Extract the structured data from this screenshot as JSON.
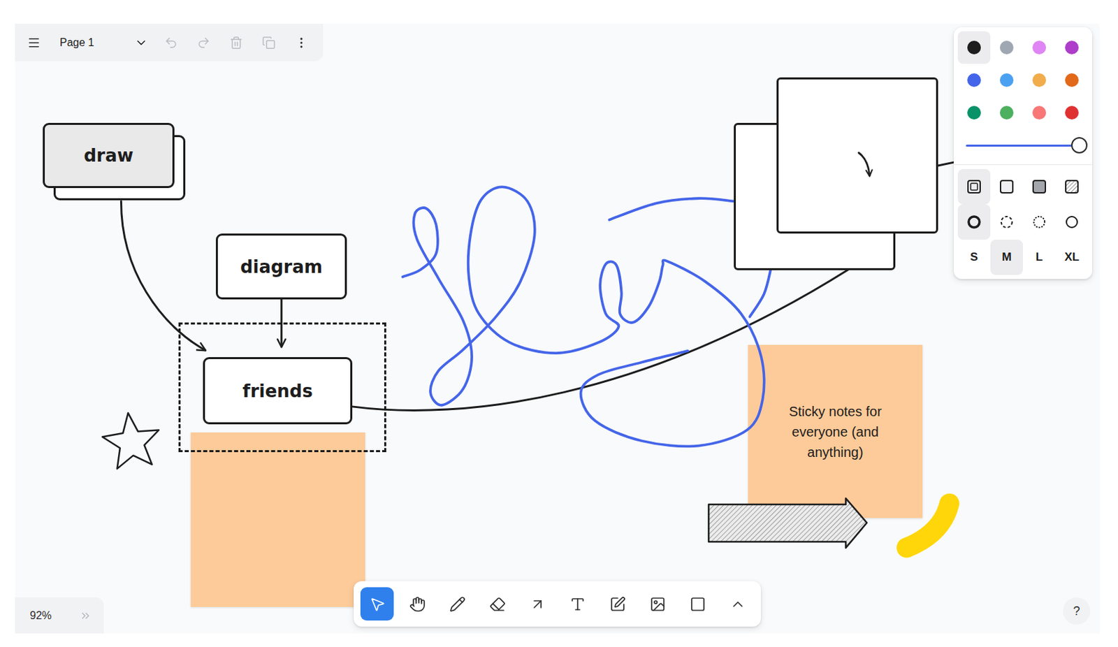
{
  "menu": {
    "page": "Page 1",
    "actions": [
      {
        "kind": "undo",
        "disabled": true
      },
      {
        "kind": "redo",
        "disabled": true
      },
      {
        "kind": "delete",
        "disabled": true
      },
      {
        "kind": "duplicate",
        "disabled": true
      },
      {
        "kind": "more",
        "disabled": false
      }
    ]
  },
  "canvas": {
    "shapes": [
      {
        "kind": "stacked",
        "label": "draw"
      },
      {
        "kind": "box",
        "label": "diagram"
      },
      {
        "kind": "box",
        "label": "friends"
      }
    ],
    "notes": [
      {
        "kind": "blank"
      },
      {
        "kind": "text",
        "text": "Sticky notes for everyone (and anything)"
      }
    ]
  },
  "style_panel": {
    "colors": [
      {
        "color": "#1d1d1d",
        "selected": true
      },
      {
        "color": "#9fa8b2",
        "selected": false
      },
      {
        "color": "#e085f4",
        "selected": false
      },
      {
        "color": "#ae3ec9",
        "selected": false
      },
      {
        "color": "#4465e9",
        "selected": false
      },
      {
        "color": "#4ba1f1",
        "selected": false
      },
      {
        "color": "#f1ac4b",
        "selected": false
      },
      {
        "color": "#e16919",
        "selected": false
      },
      {
        "color": "#099268",
        "selected": false
      },
      {
        "color": "#4cb05e",
        "selected": false
      },
      {
        "color": "#f87777",
        "selected": false
      },
      {
        "color": "#e03131",
        "selected": false
      }
    ],
    "opacity": {
      "level": 1
    },
    "fills": [
      {
        "kind": "none",
        "selected": true
      },
      {
        "kind": "semi",
        "selected": false
      },
      {
        "kind": "solid",
        "selected": false
      },
      {
        "kind": "pattern",
        "selected": false
      }
    ],
    "dashes": [
      {
        "kind": "draw",
        "selected": true
      },
      {
        "kind": "dashed",
        "selected": false
      },
      {
        "kind": "dotted",
        "selected": false
      },
      {
        "kind": "solid",
        "selected": false
      }
    ],
    "sizes": [
      {
        "label": "S",
        "selected": false
      },
      {
        "label": "M",
        "selected": true
      },
      {
        "label": "L",
        "selected": false
      },
      {
        "label": "XL",
        "selected": false
      }
    ]
  },
  "toolbar": {
    "tools": [
      {
        "kind": "select",
        "selected": true
      },
      {
        "kind": "hand",
        "selected": false
      },
      {
        "kind": "draw",
        "selected": false
      },
      {
        "kind": "eraser",
        "selected": false
      },
      {
        "kind": "arrow",
        "selected": false
      },
      {
        "kind": "text",
        "selected": false
      },
      {
        "kind": "note",
        "selected": false
      },
      {
        "kind": "asset",
        "selected": false
      },
      {
        "kind": "rectangle",
        "selected": false
      },
      {
        "kind": "more",
        "selected": false
      }
    ]
  },
  "zoom": {
    "label": "92%"
  },
  "help": {
    "label": "?"
  }
}
